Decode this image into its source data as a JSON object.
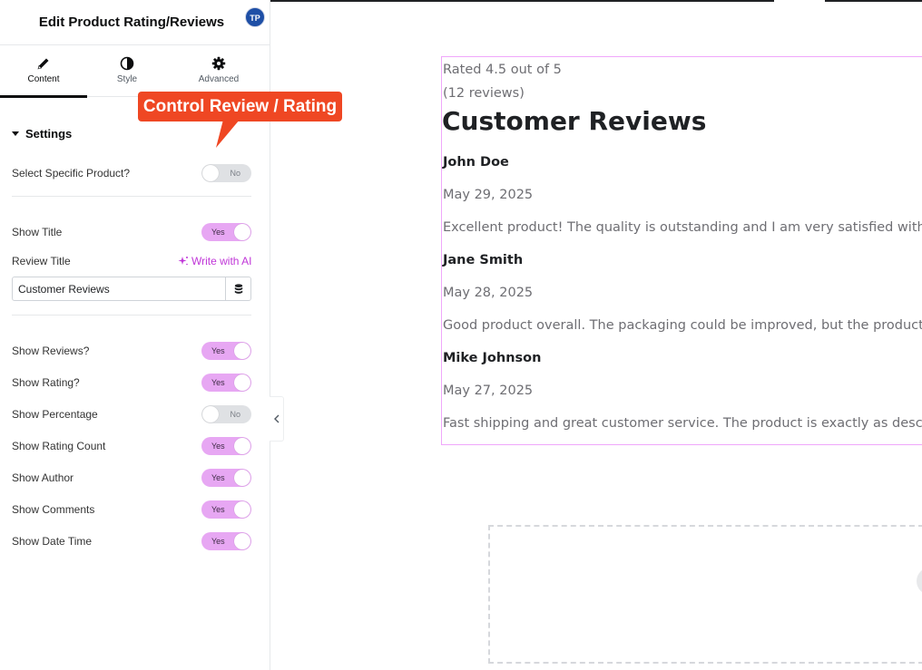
{
  "panel": {
    "title": "Edit Product Rating/Reviews",
    "avatar_initials": "TP",
    "tabs": [
      {
        "label": "Content",
        "icon": "pencil-icon",
        "active": true
      },
      {
        "label": "Style",
        "icon": "half-circle-icon",
        "active": false
      },
      {
        "label": "Advanced",
        "icon": "gear-icon",
        "active": false
      }
    ],
    "section_title": "Settings",
    "select_specific_product": {
      "label": "Select Specific Product?",
      "value": "No"
    },
    "show_title": {
      "label": "Show Title",
      "value": "Yes"
    },
    "review_title": {
      "label": "Review Title",
      "ai_label": "Write with AI",
      "value": "Customer Reviews"
    },
    "toggles": [
      {
        "label": "Show Reviews?",
        "value": "Yes"
      },
      {
        "label": "Show Rating?",
        "value": "Yes"
      },
      {
        "label": "Show Percentage",
        "value": "No"
      },
      {
        "label": "Show Rating Count",
        "value": "Yes"
      },
      {
        "label": "Show Author",
        "value": "Yes"
      },
      {
        "label": "Show Comments",
        "value": "Yes"
      },
      {
        "label": "Show Date Time",
        "value": "Yes"
      }
    ]
  },
  "callout": {
    "text": "Control Review / Rating",
    "color": "#ef4723"
  },
  "widget": {
    "rating_text": "Rated 4.5 out of 5",
    "count_text": "(12 reviews)",
    "title": "Customer Reviews",
    "reviews": [
      {
        "author": "John Doe",
        "date": "May 29, 2025",
        "comment": "Excellent product! The quality is outstanding and I am very satisfied with my"
      },
      {
        "author": "Jane Smith",
        "date": "May 28, 2025",
        "comment": "Good product overall. The packaging could be improved, but the product its"
      },
      {
        "author": "Mike Johnson",
        "date": "May 27, 2025",
        "comment": "Fast shipping and great customer service. The product is exactly as describ"
      }
    ]
  },
  "colors": {
    "toggle_on": "#e7a7f3",
    "toggle_off": "#dfe1e4",
    "ai_accent": "#c036d8",
    "widget_border": "#f0a7fb",
    "avatar": "#1e4fa6"
  }
}
